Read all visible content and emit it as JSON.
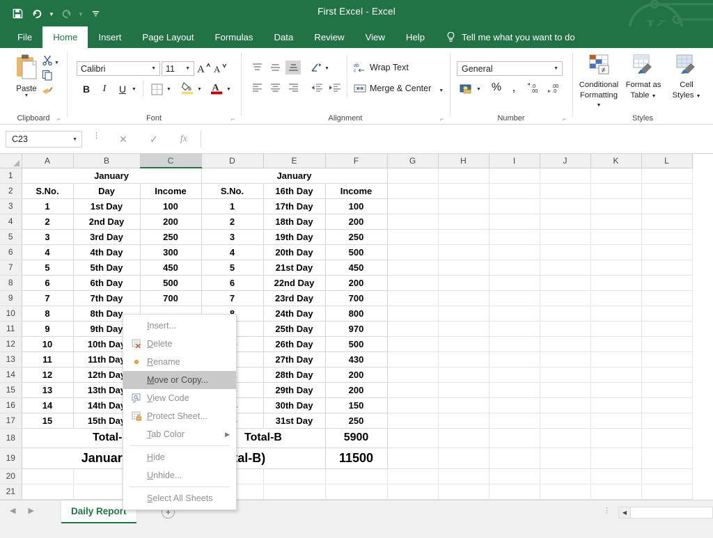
{
  "window": {
    "title": "First Excel  -  Excel",
    "quick_access": [
      {
        "name": "save-icon",
        "label": "Save",
        "enabled": true
      },
      {
        "name": "undo-icon",
        "label": "Undo",
        "enabled": true
      },
      {
        "name": "redo-icon",
        "label": "Redo",
        "enabled": false
      },
      {
        "name": "customize-qat-icon",
        "label": "Customize Quick Access Toolbar",
        "enabled": true
      }
    ],
    "watermark": "kc-logo"
  },
  "ribbon": {
    "tabs": [
      {
        "label": "File",
        "active": false
      },
      {
        "label": "Home",
        "active": true
      },
      {
        "label": "Insert",
        "active": false
      },
      {
        "label": "Page Layout",
        "active": false
      },
      {
        "label": "Formulas",
        "active": false
      },
      {
        "label": "Data",
        "active": false
      },
      {
        "label": "Review",
        "active": false
      },
      {
        "label": "View",
        "active": false
      },
      {
        "label": "Help",
        "active": false
      }
    ],
    "tell_me": "Tell me what you want to do",
    "groups": {
      "clipboard": {
        "name": "Clipboard",
        "paste_label": "Paste",
        "cut_label": "Cut",
        "copy_label": "Copy",
        "format_painter_label": "Format Painter"
      },
      "font": {
        "name": "Font",
        "font_family": "Calibri",
        "font_size": "11",
        "increase_size_label": "A",
        "decrease_size_label": "A",
        "bold_label": "B",
        "italic_label": "I",
        "underline_label": "U",
        "borders_label": "Borders",
        "fill_color_label": "Fill Color",
        "font_color_label": "Font Color"
      },
      "alignment": {
        "name": "Alignment",
        "wrap_text": "Wrap Text",
        "merge_center": "Merge & Center",
        "top_align_label": "Top Align",
        "middle_align_label": "Middle Align",
        "bottom_align_label": "Bottom Align",
        "orientation_label": "Orientation",
        "align_left_label": "Align Left",
        "center_label": "Center",
        "align_right_label": "Align Right",
        "decrease_indent_label": "Decrease Indent",
        "increase_indent_label": "Increase Indent"
      },
      "number": {
        "name": "Number",
        "format": "General",
        "accounting_label": "Accounting Number Format",
        "percent_label": "%",
        "comma_label": ",",
        "increase_decimal_label": "Increase Decimal",
        "decrease_decimal_label": "Decrease Decimal"
      },
      "styles": {
        "name": "Styles",
        "conditional_formatting": "Conditional\nFormatting",
        "conditional_formatting_l1": "Conditional",
        "conditional_formatting_l2": "Formatting",
        "format_as_table_l1": "Format as",
        "format_as_table_l2": "Table",
        "cell_styles_l1": "Cell",
        "cell_styles_l2": "Styles"
      }
    }
  },
  "formula_bar": {
    "name_box": "C23",
    "formula_value": "",
    "cancel_label": "Cancel",
    "enter_label": "Enter",
    "insert_function_label": "fx"
  },
  "grid": {
    "columns": [
      "A",
      "B",
      "C",
      "D",
      "E",
      "F",
      "G",
      "H",
      "I",
      "J",
      "K",
      "L"
    ],
    "selected_column": "C",
    "rows": [
      "1",
      "2",
      "3",
      "4",
      "5",
      "6",
      "7",
      "8",
      "9",
      "10",
      "11",
      "12",
      "13",
      "14",
      "15",
      "16",
      "17",
      "18",
      "19",
      "20",
      "21"
    ],
    "row1": {
      "left_title": "January",
      "right_title": "January"
    },
    "headers": {
      "a": "S.No.",
      "b": "Day",
      "c": "Income",
      "d": "S.No.",
      "e": "16th Day",
      "f": "Income"
    },
    "data": [
      {
        "sno_l": "1",
        "day_l": "1st Day",
        "inc_l": "100",
        "sno_r": "1",
        "day_r": "17th Day",
        "inc_r": "100"
      },
      {
        "sno_l": "2",
        "day_l": "2nd Day",
        "inc_l": "200",
        "sno_r": "2",
        "day_r": "18th Day",
        "inc_r": "200"
      },
      {
        "sno_l": "3",
        "day_l": "3rd Day",
        "inc_l": "250",
        "sno_r": "3",
        "day_r": "19th Day",
        "inc_r": "250"
      },
      {
        "sno_l": "4",
        "day_l": "4th Day",
        "inc_l": "300",
        "sno_r": "4",
        "day_r": "20th Day",
        "inc_r": "500"
      },
      {
        "sno_l": "5",
        "day_l": "5th Day",
        "inc_l": "450",
        "sno_r": "5",
        "day_r": "21st Day",
        "inc_r": "450"
      },
      {
        "sno_l": "6",
        "day_l": "6th Day",
        "inc_l": "500",
        "sno_r": "6",
        "day_r": "22nd Day",
        "inc_r": "200"
      },
      {
        "sno_l": "7",
        "day_l": "7th Day",
        "inc_l": "700",
        "sno_r": "7",
        "day_r": "23rd Day",
        "inc_r": "700"
      },
      {
        "sno_l": "8",
        "day_l": "8th Day",
        "inc_l": "",
        "sno_r": "8",
        "day_r": "24th Day",
        "inc_r": "800"
      },
      {
        "sno_l": "9",
        "day_l": "9th Day",
        "inc_l": "",
        "sno_r": "9",
        "day_r": "25th Day",
        "inc_r": "970"
      },
      {
        "sno_l": "10",
        "day_l": "10th Day",
        "inc_l": "",
        "sno_r": "10",
        "day_r": "26th Day",
        "inc_r": "500"
      },
      {
        "sno_l": "11",
        "day_l": "11th Day",
        "inc_l": "",
        "sno_r": "11",
        "day_r": "27th Day",
        "inc_r": "430"
      },
      {
        "sno_l": "12",
        "day_l": "12th Day",
        "inc_l": "",
        "sno_r": "12",
        "day_r": "28th Day",
        "inc_r": "200"
      },
      {
        "sno_l": "13",
        "day_l": "13th Day",
        "inc_l": "",
        "sno_r": "13",
        "day_r": "29th Day",
        "inc_r": "200"
      },
      {
        "sno_l": "14",
        "day_l": "14th Day",
        "inc_l": "",
        "sno_r": "14",
        "day_r": "30th Day",
        "inc_r": "150"
      },
      {
        "sno_l": "15",
        "day_l": "15th Day",
        "inc_l": "",
        "sno_r": "15",
        "day_r": "31st Day",
        "inc_r": "250"
      }
    ],
    "total_row": {
      "left_label": "Total-A",
      "left_value": "",
      "right_label": "Total-B",
      "right_value": "5900"
    },
    "grand_row": {
      "label": "January Total (Total-A+Total-B)",
      "value": "11500"
    }
  },
  "context_menu": {
    "items": [
      {
        "label": "Insert...",
        "accel": "I",
        "icon": "none",
        "highlighted": false,
        "submenu": false
      },
      {
        "label": "Delete",
        "accel": "D",
        "icon": "delete-icon",
        "highlighted": false,
        "submenu": false
      },
      {
        "label": "Rename",
        "accel": "R",
        "icon": "rename-icon",
        "highlighted": false,
        "submenu": false
      },
      {
        "label": "Move or Copy...",
        "accel": "M",
        "icon": "none",
        "highlighted": true,
        "submenu": false
      },
      {
        "label": "View Code",
        "accel": "V",
        "icon": "view-code-icon",
        "highlighted": false,
        "submenu": false
      },
      {
        "label": "Protect Sheet...",
        "accel": "P",
        "icon": "protect-icon",
        "highlighted": false,
        "submenu": false
      },
      {
        "label": "Tab Color",
        "accel": "T",
        "icon": "none",
        "highlighted": false,
        "submenu": true
      },
      {
        "label": "Hide",
        "accel": "H",
        "icon": "none",
        "highlighted": false,
        "submenu": false,
        "separator_before": true
      },
      {
        "label": "Unhide...",
        "accel": "U",
        "icon": "none",
        "highlighted": false,
        "submenu": false
      },
      {
        "label": "Select All Sheets",
        "accel": "S",
        "icon": "none",
        "highlighted": false,
        "submenu": false,
        "separator_before": true
      }
    ]
  },
  "sheet_bar": {
    "sheet_name": "Daily Report",
    "add_sheet_label": "+",
    "prev_label": "◀",
    "next_label": "▶",
    "scroll_left_label": "◀"
  },
  "colors": {
    "brand_green": "#217346",
    "tab_active_bg": "#ffffff",
    "header_bg": "#f0f0f0",
    "highlight": "#c9c9c9"
  }
}
